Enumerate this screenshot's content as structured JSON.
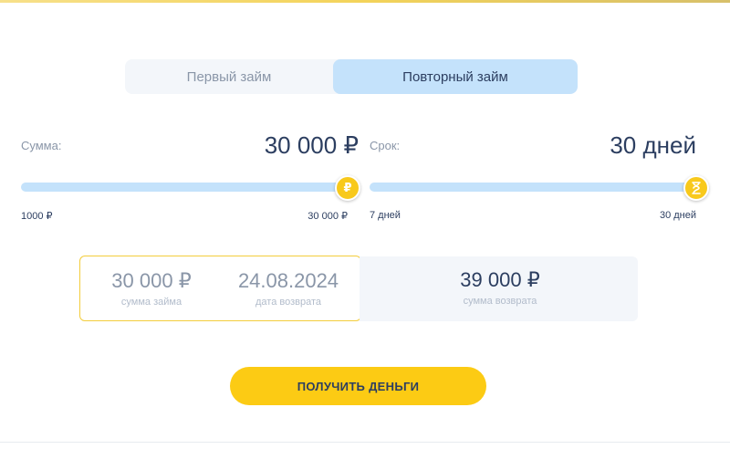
{
  "tabs": {
    "first_label": "Первый займ",
    "repeat_label": "Повторный займ"
  },
  "amount": {
    "label": "Сумма:",
    "value": "30 000 ₽",
    "min": "1000 ₽",
    "max": "30 000 ₽",
    "thumb_icon": "₽",
    "fill_fraction": 1.0
  },
  "term": {
    "label": "Срок:",
    "value": "30 дней",
    "min": "7 дней",
    "max": "30 дней",
    "thumb_icon": "hourglass-icon",
    "fill_fraction": 1.0
  },
  "summary": {
    "loan_amount": "30 000 ₽",
    "loan_amount_label": "сумма займа",
    "return_date": "24.08.2024",
    "return_date_label": "дата возврата",
    "return_amount": "39 000 ₽",
    "return_amount_label": "сумма возврата"
  },
  "cta": {
    "label": "ПОЛУЧИТЬ ДЕНЬГИ"
  },
  "colors": {
    "accent": "#fccb14",
    "track": "#c4e2fb",
    "text": "#2c3e60",
    "muted": "#8a96a8"
  }
}
